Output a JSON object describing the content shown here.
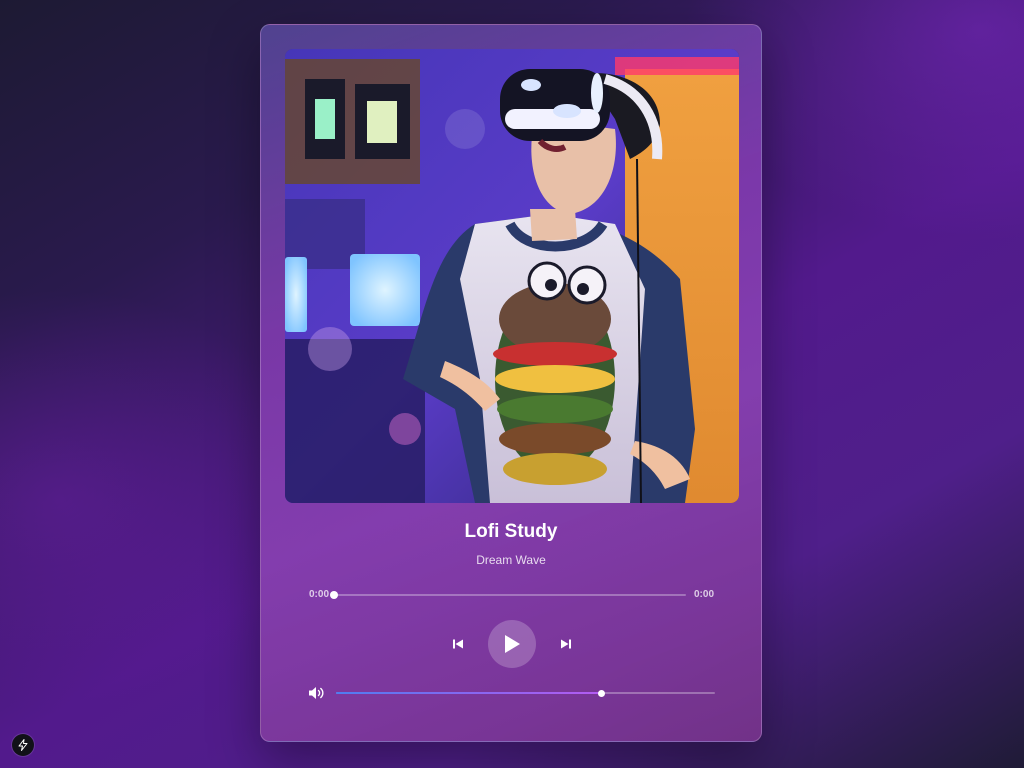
{
  "track": {
    "title": "Lofi Study",
    "artist": "Dream Wave",
    "album_art": "person wearing VR headset in neon-lit arcade"
  },
  "progress": {
    "current_time": "0:00",
    "total_time": "0:00",
    "fraction": 0.0
  },
  "controls": {
    "previous_icon": "skip-previous-icon",
    "play_icon": "play-icon",
    "next_icon": "skip-next-icon",
    "volume_icon": "volume-icon"
  },
  "volume": {
    "level": 0.7
  },
  "dev_badge": {
    "icon": "lightning-icon"
  },
  "colors": {
    "volume_gradient_start": "#4f7df0",
    "volume_gradient_end": "#b45cf2"
  }
}
